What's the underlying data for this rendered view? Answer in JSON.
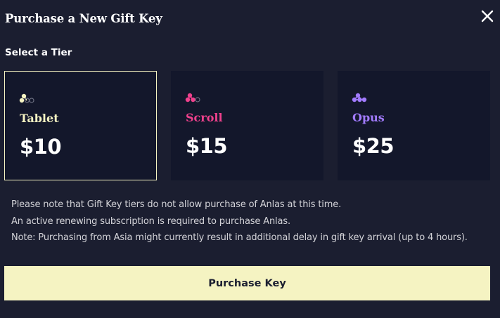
{
  "dialog": {
    "title": "Purchase a New Gift Key",
    "section_label": "Select a Tier"
  },
  "tiers": [
    {
      "name": "Tablet",
      "price": "$10",
      "color": "#f5f3c2",
      "selected": true,
      "icon": "tablet-tier-icon"
    },
    {
      "name": "Scroll",
      "price": "$15",
      "color": "#f0418d",
      "selected": false,
      "icon": "scroll-tier-icon"
    },
    {
      "name": "Opus",
      "price": "$25",
      "color": "#a27bff",
      "selected": false,
      "icon": "opus-tier-icon"
    }
  ],
  "notes": [
    "Please note that Gift Key tiers do not allow purchase of Anlas at this time.",
    "An active renewing subscription is required to purchase Anlas.",
    "Note: Purchasing from Asia might currently result in additional delay in gift key arrival (up to 4 hours)."
  ],
  "purchase_button": {
    "label": "Purchase Key"
  },
  "colors": {
    "background": "#1b1e30",
    "card": "#13172b",
    "accent": "#f5f3c2"
  }
}
